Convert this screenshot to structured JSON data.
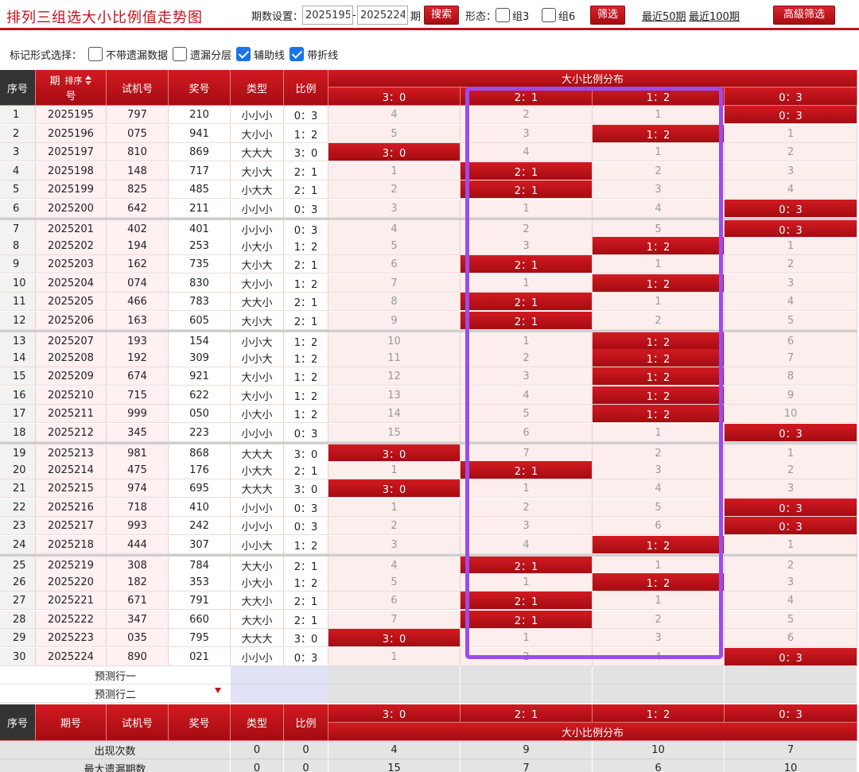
{
  "page_title": "排列三组选大小比例值走势图",
  "toolbar": {
    "period_label": "期数设置：",
    "period_from": "2025195",
    "dash": "-",
    "period_to": "2025224",
    "period_unit": "期",
    "search_label": "搜索",
    "shape_label": "形态：",
    "group3_label": "组3",
    "group6_label": "组6",
    "filter_label": "筛选",
    "recent50_label": "最近50期",
    "recent100_label": "最近100期",
    "advanced_label": "高級筛选"
  },
  "markers": {
    "label": "标记形式选择：",
    "options": [
      {
        "label": "不带遗漏数据",
        "checked": false
      },
      {
        "label": "遗漏分层",
        "checked": false
      },
      {
        "label": "辅助线",
        "checked": true
      },
      {
        "label": "带折线",
        "checked": true
      }
    ]
  },
  "header": {
    "seq": "序号",
    "period_top": "期",
    "period_sort": "排序",
    "period_bottom": "号",
    "period": "期号",
    "trial": "试机号",
    "draw": "奖号",
    "type": "类型",
    "ratio": "比例",
    "dist_title": "大小比例分布",
    "dist_cols": [
      "3：0",
      "2：1",
      "1：2",
      "0：3"
    ]
  },
  "rows": [
    {
      "seq": "1",
      "period": "2025195",
      "trial": "797",
      "draw": "210",
      "type": "小小小",
      "ratio": "0：3",
      "dist": [
        "4",
        "2",
        "1",
        "0：3"
      ],
      "hit": 3
    },
    {
      "seq": "2",
      "period": "2025196",
      "trial": "075",
      "draw": "941",
      "type": "大小小",
      "ratio": "1：2",
      "dist": [
        "5",
        "3",
        "1：2",
        "1"
      ],
      "hit": 2
    },
    {
      "seq": "3",
      "period": "2025197",
      "trial": "810",
      "draw": "869",
      "type": "大大大",
      "ratio": "3：0",
      "dist": [
        "3：0",
        "4",
        "1",
        "2"
      ],
      "hit": 0
    },
    {
      "seq": "4",
      "period": "2025198",
      "trial": "148",
      "draw": "717",
      "type": "大小大",
      "ratio": "2：1",
      "dist": [
        "1",
        "2：1",
        "2",
        "3"
      ],
      "hit": 1
    },
    {
      "seq": "5",
      "period": "2025199",
      "trial": "825",
      "draw": "485",
      "type": "小大大",
      "ratio": "2：1",
      "dist": [
        "2",
        "2：1",
        "3",
        "4"
      ],
      "hit": 1
    },
    {
      "seq": "6",
      "period": "2025200",
      "trial": "642",
      "draw": "211",
      "type": "小小小",
      "ratio": "0：3",
      "dist": [
        "3",
        "1",
        "4",
        "0：3"
      ],
      "hit": 3
    },
    {
      "seq": "7",
      "period": "2025201",
      "trial": "402",
      "draw": "401",
      "type": "小小小",
      "ratio": "0：3",
      "dist": [
        "4",
        "2",
        "5",
        "0：3"
      ],
      "hit": 3
    },
    {
      "seq": "8",
      "period": "2025202",
      "trial": "194",
      "draw": "253",
      "type": "小大小",
      "ratio": "1：2",
      "dist": [
        "5",
        "3",
        "1：2",
        "1"
      ],
      "hit": 2
    },
    {
      "seq": "9",
      "period": "2025203",
      "trial": "162",
      "draw": "735",
      "type": "大小大",
      "ratio": "2：1",
      "dist": [
        "6",
        "2：1",
        "1",
        "2"
      ],
      "hit": 1
    },
    {
      "seq": "10",
      "period": "2025204",
      "trial": "074",
      "draw": "830",
      "type": "大小小",
      "ratio": "1：2",
      "dist": [
        "7",
        "1",
        "1：2",
        "3"
      ],
      "hit": 2
    },
    {
      "seq": "11",
      "period": "2025205",
      "trial": "466",
      "draw": "783",
      "type": "大大小",
      "ratio": "2：1",
      "dist": [
        "8",
        "2：1",
        "1",
        "4"
      ],
      "hit": 1
    },
    {
      "seq": "12",
      "period": "2025206",
      "trial": "163",
      "draw": "605",
      "type": "大小大",
      "ratio": "2：1",
      "dist": [
        "9",
        "2：1",
        "2",
        "5"
      ],
      "hit": 1
    },
    {
      "seq": "13",
      "period": "2025207",
      "trial": "193",
      "draw": "154",
      "type": "小小大",
      "ratio": "1：2",
      "dist": [
        "10",
        "1",
        "1：2",
        "6"
      ],
      "hit": 2
    },
    {
      "seq": "14",
      "period": "2025208",
      "trial": "192",
      "draw": "309",
      "type": "小小大",
      "ratio": "1：2",
      "dist": [
        "11",
        "2",
        "1：2",
        "7"
      ],
      "hit": 2
    },
    {
      "seq": "15",
      "period": "2025209",
      "trial": "674",
      "draw": "921",
      "type": "大小小",
      "ratio": "1：2",
      "dist": [
        "12",
        "3",
        "1：2",
        "8"
      ],
      "hit": 2
    },
    {
      "seq": "16",
      "period": "2025210",
      "trial": "715",
      "draw": "622",
      "type": "大小小",
      "ratio": "1：2",
      "dist": [
        "13",
        "4",
        "1：2",
        "9"
      ],
      "hit": 2
    },
    {
      "seq": "17",
      "period": "2025211",
      "trial": "999",
      "draw": "050",
      "type": "小大小",
      "ratio": "1：2",
      "dist": [
        "14",
        "5",
        "1：2",
        "10"
      ],
      "hit": 2
    },
    {
      "seq": "18",
      "period": "2025212",
      "trial": "345",
      "draw": "223",
      "type": "小小小",
      "ratio": "0：3",
      "dist": [
        "15",
        "6",
        "1",
        "0：3"
      ],
      "hit": 3
    },
    {
      "seq": "19",
      "period": "2025213",
      "trial": "981",
      "draw": "868",
      "type": "大大大",
      "ratio": "3：0",
      "dist": [
        "3：0",
        "7",
        "2",
        "1"
      ],
      "hit": 0
    },
    {
      "seq": "20",
      "period": "2025214",
      "trial": "475",
      "draw": "176",
      "type": "小大大",
      "ratio": "2：1",
      "dist": [
        "1",
        "2：1",
        "3",
        "2"
      ],
      "hit": 1
    },
    {
      "seq": "21",
      "period": "2025215",
      "trial": "974",
      "draw": "695",
      "type": "大大大",
      "ratio": "3：0",
      "dist": [
        "3：0",
        "1",
        "4",
        "3"
      ],
      "hit": 0
    },
    {
      "seq": "22",
      "period": "2025216",
      "trial": "718",
      "draw": "410",
      "type": "小小小",
      "ratio": "0：3",
      "dist": [
        "1",
        "2",
        "5",
        "0：3"
      ],
      "hit": 3
    },
    {
      "seq": "23",
      "period": "2025217",
      "trial": "993",
      "draw": "242",
      "type": "小小小",
      "ratio": "0：3",
      "dist": [
        "2",
        "3",
        "6",
        "0：3"
      ],
      "hit": 3
    },
    {
      "seq": "24",
      "period": "2025218",
      "trial": "444",
      "draw": "307",
      "type": "小小大",
      "ratio": "1：2",
      "dist": [
        "3",
        "4",
        "1：2",
        "1"
      ],
      "hit": 2
    },
    {
      "seq": "25",
      "period": "2025219",
      "trial": "308",
      "draw": "784",
      "type": "大大小",
      "ratio": "2：1",
      "dist": [
        "4",
        "2：1",
        "1",
        "2"
      ],
      "hit": 1
    },
    {
      "seq": "26",
      "period": "2025220",
      "trial": "182",
      "draw": "353",
      "type": "小大小",
      "ratio": "1：2",
      "dist": [
        "5",
        "1",
        "1：2",
        "3"
      ],
      "hit": 2
    },
    {
      "seq": "27",
      "period": "2025221",
      "trial": "671",
      "draw": "791",
      "type": "大大小",
      "ratio": "2：1",
      "dist": [
        "6",
        "2：1",
        "1",
        "4"
      ],
      "hit": 1
    },
    {
      "seq": "28",
      "period": "2025222",
      "trial": "347",
      "draw": "660",
      "type": "大大小",
      "ratio": "2：1",
      "dist": [
        "7",
        "2：1",
        "2",
        "5"
      ],
      "hit": 1
    },
    {
      "seq": "29",
      "period": "2025223",
      "trial": "035",
      "draw": "795",
      "type": "大大大",
      "ratio": "3：0",
      "dist": [
        "3：0",
        "1",
        "3",
        "6"
      ],
      "hit": 0
    },
    {
      "seq": "30",
      "period": "2025224",
      "trial": "890",
      "draw": "021",
      "type": "小小小",
      "ratio": "0：3",
      "dist": [
        "1",
        "2",
        "4",
        "0：3"
      ],
      "hit": 3
    }
  ],
  "predict": [
    "预测行一",
    "预测行二"
  ],
  "stats": [
    {
      "label": "出现次数",
      "type": "0",
      "ratio": "0",
      "dist": [
        "4",
        "9",
        "10",
        "7"
      ]
    },
    {
      "label": "最大遗漏期数",
      "type": "0",
      "ratio": "0",
      "dist": [
        "15",
        "7",
        "6",
        "10"
      ]
    }
  ],
  "colors": {
    "accent": "#c4121c",
    "highlight_box": "#9b4dea",
    "checkbox": "#1a73e8"
  }
}
